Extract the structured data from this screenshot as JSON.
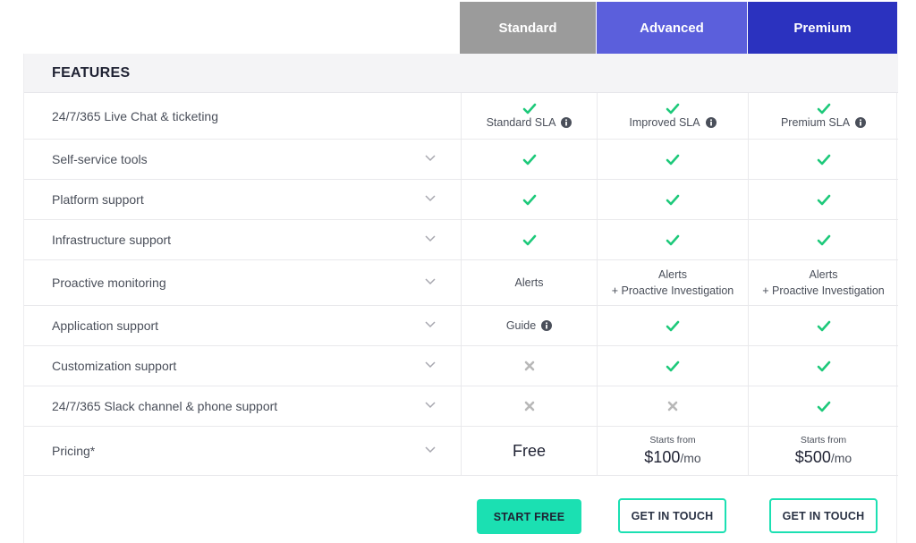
{
  "plans": [
    {
      "name": "Standard",
      "color": "#9b9b9b"
    },
    {
      "name": "Advanced",
      "color": "#5b5fdc"
    },
    {
      "name": "Premium",
      "color": "#2b32bf"
    }
  ],
  "features_header": "FEATURES",
  "rows": [
    {
      "label": "24/7/365 Live Chat & ticketing",
      "std": "Standard SLA",
      "adv": "Improved SLA",
      "pre": "Premium SLA"
    },
    {
      "label": "Self-service tools"
    },
    {
      "label": "Platform support"
    },
    {
      "label": "Infrastructure support"
    },
    {
      "label": "Proactive monitoring",
      "std": "Alerts",
      "adv_line1": "Alerts",
      "adv_line2": "+ Proactive Investigation",
      "pre_line1": "Alerts",
      "pre_line2": "+ Proactive Investigation"
    },
    {
      "label": "Application support",
      "std": "Guide"
    },
    {
      "label": "Customization support"
    },
    {
      "label": "24/7/365 Slack channel & phone support"
    },
    {
      "label": "Pricing*",
      "std": "Free",
      "adv_from": "Starts from",
      "adv_price": "$100",
      "adv_unit": "/mo",
      "pre_from": "Starts from",
      "pre_price": "$500",
      "pre_unit": "/mo"
    }
  ],
  "buttons": {
    "standard": "START FREE",
    "advanced": "GET IN TOUCH",
    "premium": "GET IN TOUCH"
  },
  "icons": {
    "check": "check-icon",
    "cross": "x-icon",
    "info": "info-icon",
    "chevron": "chevron-down-icon"
  },
  "colors": {
    "check": "#1dc97a",
    "cross": "#b8b8b8",
    "accent": "#1be0b2"
  }
}
